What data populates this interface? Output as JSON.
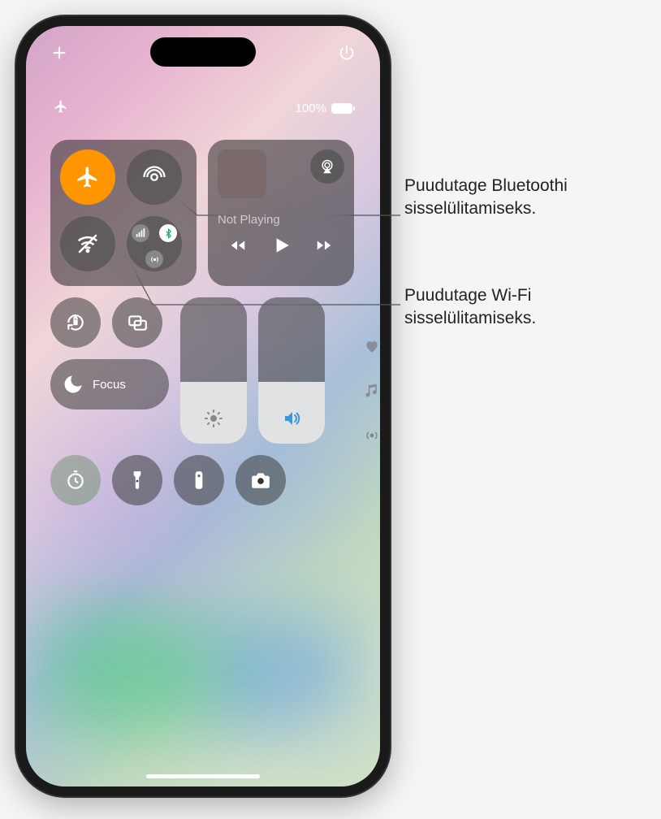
{
  "status": {
    "battery_percent": "100%"
  },
  "media": {
    "title": "Not Playing"
  },
  "focus": {
    "label": "Focus"
  },
  "sliders": {
    "brightness_percent": 42,
    "volume_percent": 42
  },
  "callouts": {
    "bluetooth": "Puudutage Bluetoothi sisselülitamiseks.",
    "wifi": "Puudutage Wi-Fi sisselülitamiseks."
  },
  "icons": {
    "add": "plus-icon",
    "power": "power-icon",
    "airplane_status": "airplane-icon",
    "airplane": "airplane-icon",
    "airdrop": "airdrop-icon",
    "wifi": "wifi-off-icon",
    "cluster": "connectivity-cluster-icon",
    "airplay": "airplay-icon",
    "prev": "backward-icon",
    "play": "play-icon",
    "next": "forward-icon",
    "lock_rotation": "rotation-lock-icon",
    "mirroring": "screen-mirroring-icon",
    "moon": "moon-icon",
    "brightness": "sun-icon",
    "volume": "speaker-icon",
    "heart": "heart-icon",
    "music": "music-note-icon",
    "hotspot_side": "hotspot-icon",
    "timer": "timer-icon",
    "flashlight": "flashlight-icon",
    "remote": "remote-icon",
    "camera": "camera-icon"
  }
}
